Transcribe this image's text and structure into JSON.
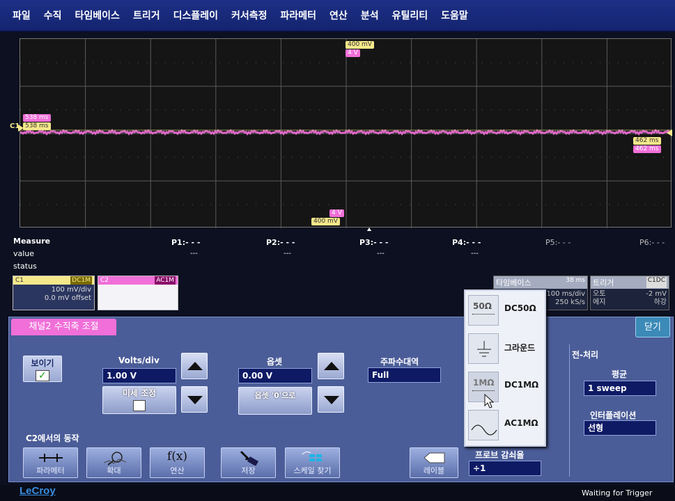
{
  "menu": [
    "파일",
    "수직",
    "타임베이스",
    "트리거",
    "디스플레이",
    "커서측정",
    "파라메터",
    "연산",
    "분석",
    "유틸리티",
    "도움말"
  ],
  "grid": {
    "top_tag_1": "400 mV",
    "top_tag_2": "4 V",
    "left_tag_1": "538 ms",
    "left_tag_2": "538 ms",
    "right_tag_1": "462 ms",
    "right_tag_2": "462 ms",
    "bottom_tag_1": "4 V",
    "bottom_tag_2": "400 mV",
    "channel_marker": "C1",
    "colors": {
      "trace": "#f06fd8",
      "c1": "#f5e88a",
      "c2": "#f06fd8"
    }
  },
  "measure": {
    "title": "Measure",
    "row_value": "value",
    "row_status": "status",
    "params": [
      {
        "label": "P1:- - -",
        "value": "---"
      },
      {
        "label": "P2:- - -",
        "value": "---"
      },
      {
        "label": "P3:- - -",
        "value": "---"
      },
      {
        "label": "P4:- - -",
        "value": "---"
      },
      {
        "label": "P5:- - -",
        "value": ""
      },
      {
        "label": "P6:- - -",
        "value": ""
      }
    ]
  },
  "channels": {
    "c1": {
      "name": "C1",
      "coupling": "DC1M",
      "vdiv": "100 mV/div",
      "offset": "0.0 mV offset"
    },
    "c2": {
      "name": "C2",
      "coupling": "AC1M"
    }
  },
  "timebase": {
    "title": "타임베이스",
    "delay": "38 ms",
    "tdiv": "100 ms/div",
    "rate": "250 kS/s"
  },
  "trigger": {
    "title": "트리거",
    "source": "C1DC",
    "mode": "오토",
    "type": "에지",
    "level": "-2 mV",
    "slope": "하강"
  },
  "dialog": {
    "tab": "채널2 수직축 조절",
    "close": "닫기",
    "show_label": "보이기",
    "volts_div_label": "Volts/div",
    "volts_div_value": "1.00 V",
    "fine_label": "미세 조정",
    "offset_label": "옵셋",
    "offset_value": "0.00 V",
    "offset_zero": "옵셋 '0'으로",
    "bandwidth_label": "주파수대역",
    "bandwidth_value": "Full",
    "actions_label": "C2에서의 동작",
    "tools": [
      "파라메터",
      "확대",
      "연산",
      "저장",
      "스케일 찾기"
    ],
    "label_btn": "레이블",
    "probe_label": "프로브 감쇠율",
    "probe_value": "÷1",
    "preprocess_label": "전-처리",
    "avg_label": "평균",
    "avg_value": "1 sweep",
    "interp_label": "인터폴레이션",
    "interp_value": "선형"
  },
  "coupling_menu": [
    {
      "icon": "50Ω",
      "label": "DC50Ω"
    },
    {
      "icon": "",
      "label": "그라운드"
    },
    {
      "icon": "1MΩ",
      "label": "DC1MΩ"
    },
    {
      "icon": "",
      "label": "AC1MΩ"
    }
  ],
  "status": {
    "logo": "LeCroy",
    "text": "Waiting for Trigger"
  }
}
